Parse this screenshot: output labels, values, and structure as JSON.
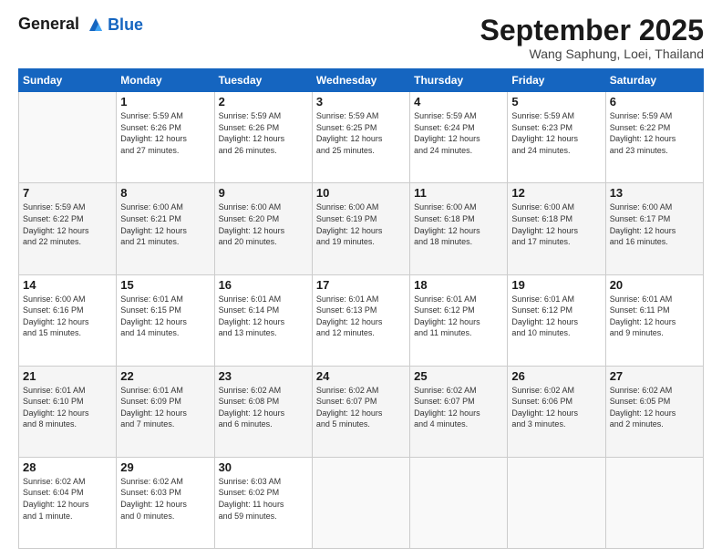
{
  "header": {
    "logo_line1": "General",
    "logo_line2": "Blue",
    "month_title": "September 2025",
    "subtitle": "Wang Saphung, Loei, Thailand"
  },
  "days_of_week": [
    "Sunday",
    "Monday",
    "Tuesday",
    "Wednesday",
    "Thursday",
    "Friday",
    "Saturday"
  ],
  "weeks": [
    [
      {
        "num": "",
        "info": ""
      },
      {
        "num": "1",
        "info": "Sunrise: 5:59 AM\nSunset: 6:26 PM\nDaylight: 12 hours\nand 27 minutes."
      },
      {
        "num": "2",
        "info": "Sunrise: 5:59 AM\nSunset: 6:26 PM\nDaylight: 12 hours\nand 26 minutes."
      },
      {
        "num": "3",
        "info": "Sunrise: 5:59 AM\nSunset: 6:25 PM\nDaylight: 12 hours\nand 25 minutes."
      },
      {
        "num": "4",
        "info": "Sunrise: 5:59 AM\nSunset: 6:24 PM\nDaylight: 12 hours\nand 24 minutes."
      },
      {
        "num": "5",
        "info": "Sunrise: 5:59 AM\nSunset: 6:23 PM\nDaylight: 12 hours\nand 24 minutes."
      },
      {
        "num": "6",
        "info": "Sunrise: 5:59 AM\nSunset: 6:22 PM\nDaylight: 12 hours\nand 23 minutes."
      }
    ],
    [
      {
        "num": "7",
        "info": "Sunrise: 5:59 AM\nSunset: 6:22 PM\nDaylight: 12 hours\nand 22 minutes."
      },
      {
        "num": "8",
        "info": "Sunrise: 6:00 AM\nSunset: 6:21 PM\nDaylight: 12 hours\nand 21 minutes."
      },
      {
        "num": "9",
        "info": "Sunrise: 6:00 AM\nSunset: 6:20 PM\nDaylight: 12 hours\nand 20 minutes."
      },
      {
        "num": "10",
        "info": "Sunrise: 6:00 AM\nSunset: 6:19 PM\nDaylight: 12 hours\nand 19 minutes."
      },
      {
        "num": "11",
        "info": "Sunrise: 6:00 AM\nSunset: 6:18 PM\nDaylight: 12 hours\nand 18 minutes."
      },
      {
        "num": "12",
        "info": "Sunrise: 6:00 AM\nSunset: 6:18 PM\nDaylight: 12 hours\nand 17 minutes."
      },
      {
        "num": "13",
        "info": "Sunrise: 6:00 AM\nSunset: 6:17 PM\nDaylight: 12 hours\nand 16 minutes."
      }
    ],
    [
      {
        "num": "14",
        "info": "Sunrise: 6:00 AM\nSunset: 6:16 PM\nDaylight: 12 hours\nand 15 minutes."
      },
      {
        "num": "15",
        "info": "Sunrise: 6:01 AM\nSunset: 6:15 PM\nDaylight: 12 hours\nand 14 minutes."
      },
      {
        "num": "16",
        "info": "Sunrise: 6:01 AM\nSunset: 6:14 PM\nDaylight: 12 hours\nand 13 minutes."
      },
      {
        "num": "17",
        "info": "Sunrise: 6:01 AM\nSunset: 6:13 PM\nDaylight: 12 hours\nand 12 minutes."
      },
      {
        "num": "18",
        "info": "Sunrise: 6:01 AM\nSunset: 6:12 PM\nDaylight: 12 hours\nand 11 minutes."
      },
      {
        "num": "19",
        "info": "Sunrise: 6:01 AM\nSunset: 6:12 PM\nDaylight: 12 hours\nand 10 minutes."
      },
      {
        "num": "20",
        "info": "Sunrise: 6:01 AM\nSunset: 6:11 PM\nDaylight: 12 hours\nand 9 minutes."
      }
    ],
    [
      {
        "num": "21",
        "info": "Sunrise: 6:01 AM\nSunset: 6:10 PM\nDaylight: 12 hours\nand 8 minutes."
      },
      {
        "num": "22",
        "info": "Sunrise: 6:01 AM\nSunset: 6:09 PM\nDaylight: 12 hours\nand 7 minutes."
      },
      {
        "num": "23",
        "info": "Sunrise: 6:02 AM\nSunset: 6:08 PM\nDaylight: 12 hours\nand 6 minutes."
      },
      {
        "num": "24",
        "info": "Sunrise: 6:02 AM\nSunset: 6:07 PM\nDaylight: 12 hours\nand 5 minutes."
      },
      {
        "num": "25",
        "info": "Sunrise: 6:02 AM\nSunset: 6:07 PM\nDaylight: 12 hours\nand 4 minutes."
      },
      {
        "num": "26",
        "info": "Sunrise: 6:02 AM\nSunset: 6:06 PM\nDaylight: 12 hours\nand 3 minutes."
      },
      {
        "num": "27",
        "info": "Sunrise: 6:02 AM\nSunset: 6:05 PM\nDaylight: 12 hours\nand 2 minutes."
      }
    ],
    [
      {
        "num": "28",
        "info": "Sunrise: 6:02 AM\nSunset: 6:04 PM\nDaylight: 12 hours\nand 1 minute."
      },
      {
        "num": "29",
        "info": "Sunrise: 6:02 AM\nSunset: 6:03 PM\nDaylight: 12 hours\nand 0 minutes."
      },
      {
        "num": "30",
        "info": "Sunrise: 6:03 AM\nSunset: 6:02 PM\nDaylight: 11 hours\nand 59 minutes."
      },
      {
        "num": "",
        "info": ""
      },
      {
        "num": "",
        "info": ""
      },
      {
        "num": "",
        "info": ""
      },
      {
        "num": "",
        "info": ""
      }
    ]
  ]
}
